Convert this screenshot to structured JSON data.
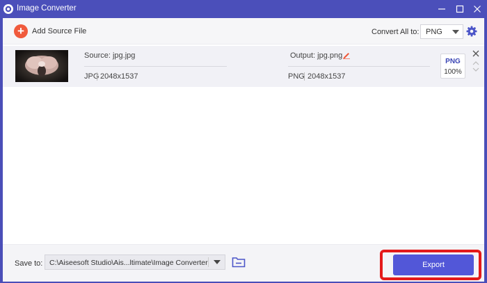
{
  "window": {
    "title": "Image Converter",
    "icon": "app-logo-icon",
    "controls": [
      "minimize-icon",
      "maximize-icon",
      "close-icon"
    ]
  },
  "toolbar": {
    "add_source_label": "Add Source File",
    "convert_all_label": "Convert All to:",
    "convert_all_value": "PNG"
  },
  "files": [
    {
      "source_label": "Source: jpg.jpg",
      "source_format": "JPG",
      "source_resolution": "2048x1537",
      "output_label": "Output: jpg.png",
      "output_format": "PNG",
      "output_resolution": "2048x1537",
      "format_badge": "PNG",
      "quality": "100%"
    }
  ],
  "footer": {
    "save_to_label": "Save to:",
    "save_path": "C:\\Aiseesoft Studio\\Ais...ltimate\\Image Converter",
    "export_label": "Export"
  },
  "colors": {
    "title_bar": "#4b4fba",
    "accent": "#5257d8",
    "add_icon": "#f05a3c",
    "highlight": "#e41a1a"
  }
}
